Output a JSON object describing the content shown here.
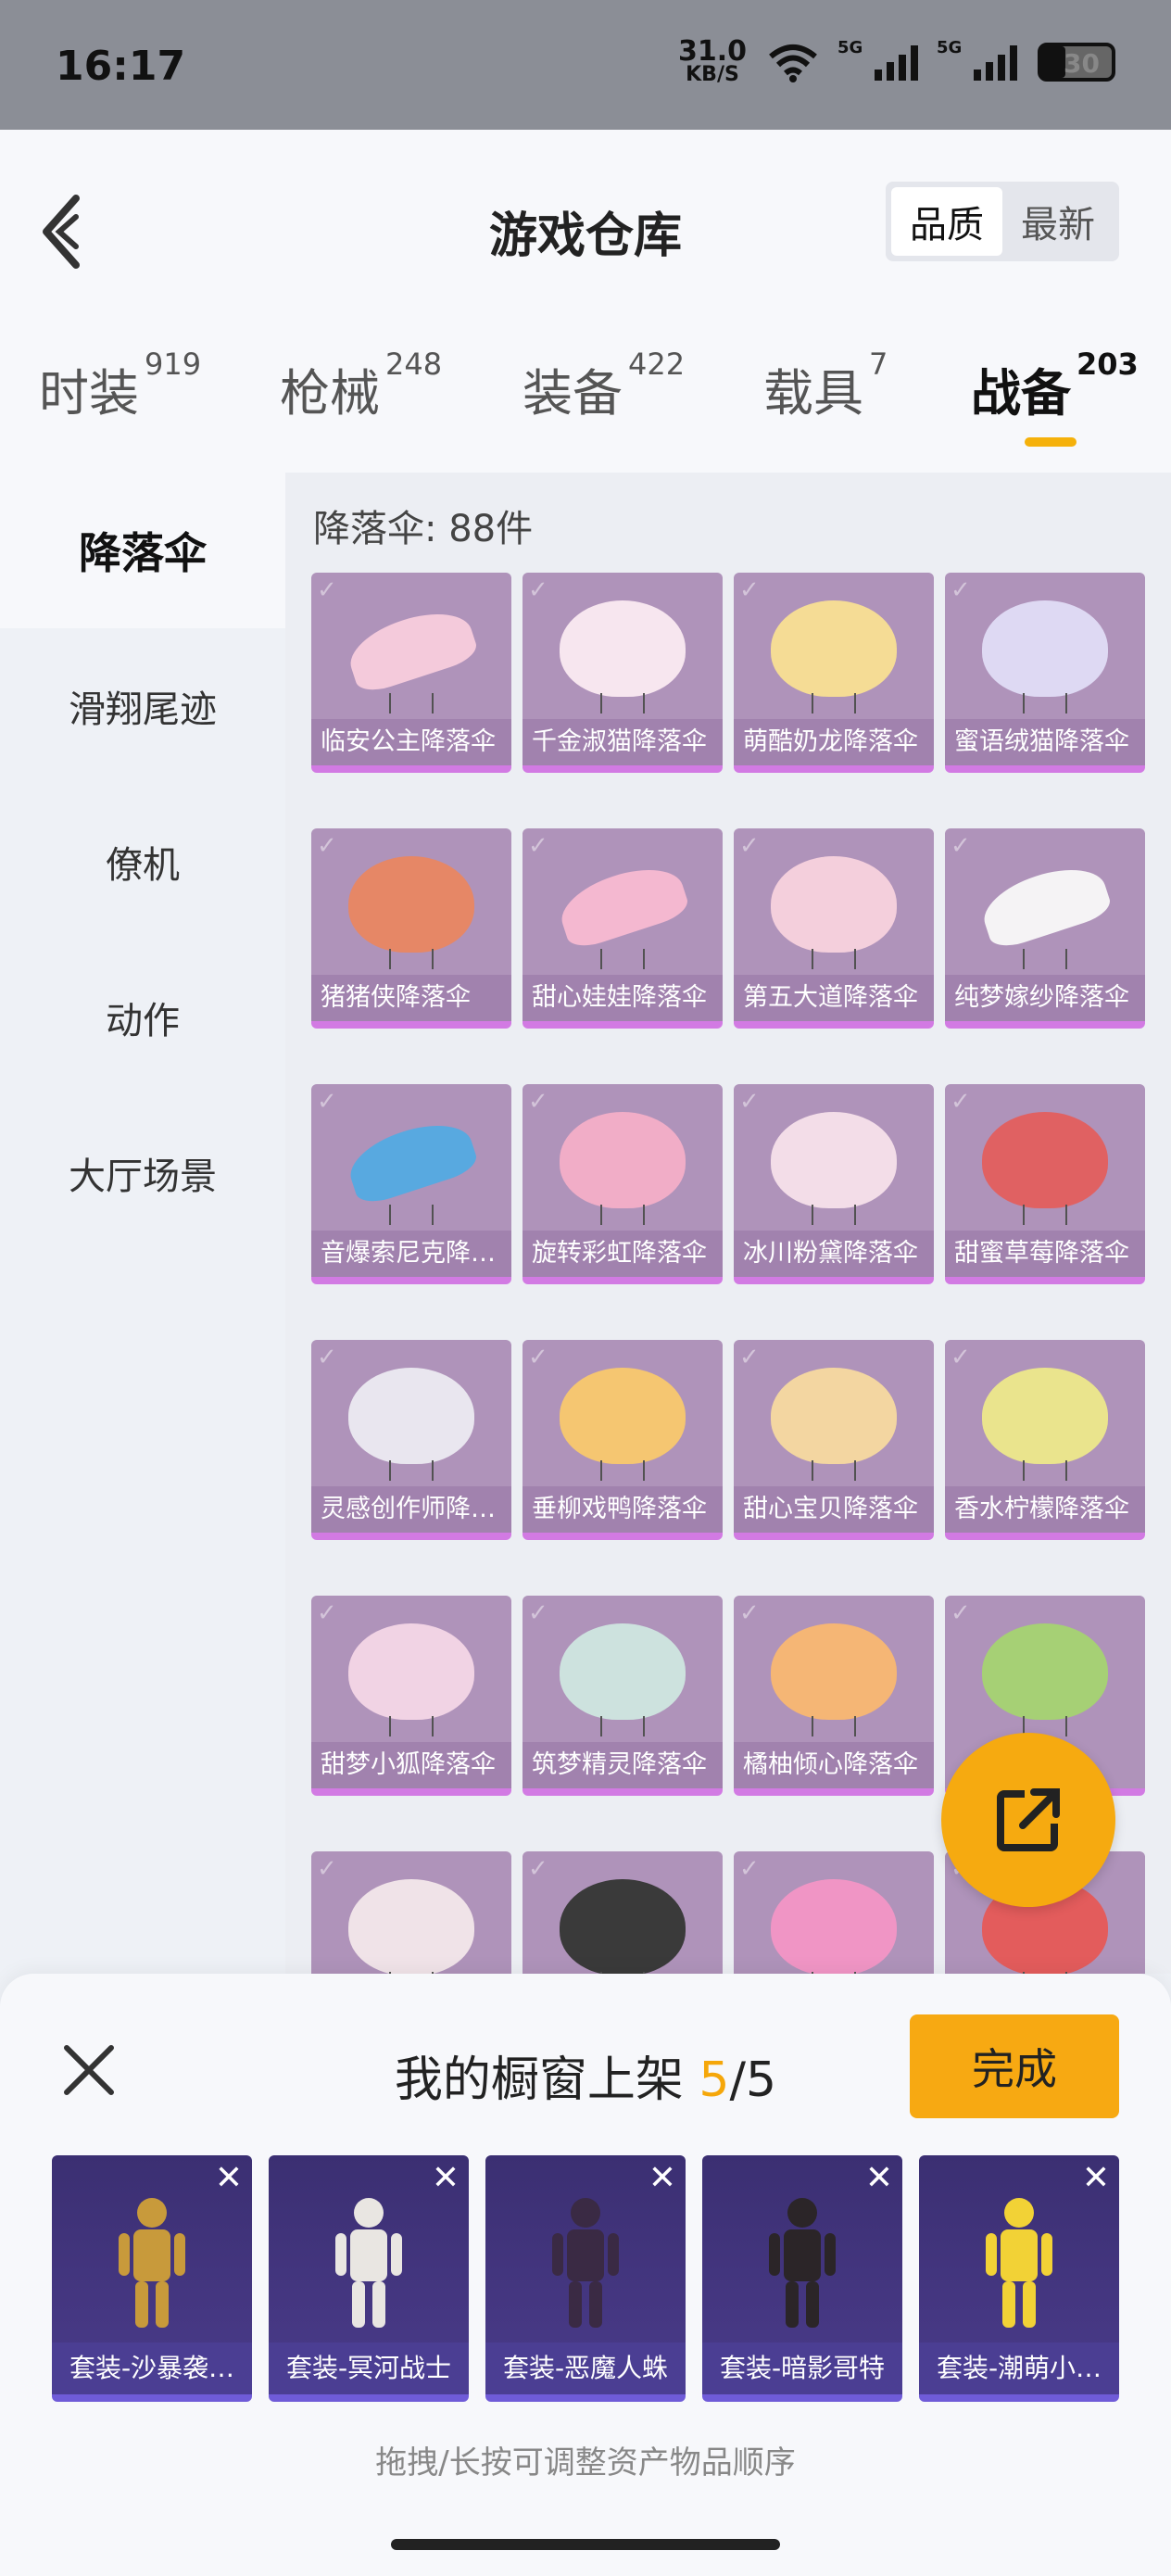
{
  "status": {
    "time": "16:17",
    "speed_value": "31.0",
    "speed_unit": "KB/S",
    "sig1": "5G",
    "sig2": "5G",
    "battery": "30"
  },
  "header": {
    "title": "游戏仓库",
    "sort": [
      "品质",
      "最新"
    ],
    "sort_active": "品质"
  },
  "tabs": [
    {
      "label": "时装",
      "count": "919"
    },
    {
      "label": "枪械",
      "count": "248"
    },
    {
      "label": "装备",
      "count": "422"
    },
    {
      "label": "载具",
      "count": "7"
    },
    {
      "label": "战备",
      "count": "203"
    }
  ],
  "active_tab": "战备",
  "sidebar": [
    "降落伞",
    "滑翔尾迹",
    "僚机",
    "动作",
    "大厅场景"
  ],
  "active_category": "降落伞",
  "content": {
    "count_label": "降落伞: 88件",
    "items": [
      {
        "name": "临安公主降落伞",
        "color": "#f4c6d8"
      },
      {
        "name": "千金淑猫降落伞",
        "color": "#f7e4ee"
      },
      {
        "name": "萌酷奶龙降落伞",
        "color": "#f5d98c"
      },
      {
        "name": "蜜语绒猫降落伞",
        "color": "#dcd6f2"
      },
      {
        "name": "猪猪侠降落伞",
        "color": "#e47d5a"
      },
      {
        "name": "甜心娃娃降落伞",
        "color": "#f3b2cc"
      },
      {
        "name": "第五大道降落伞",
        "color": "#f3cbd9"
      },
      {
        "name": "纯梦嫁纱降落伞",
        "color": "#f5f2f5"
      },
      {
        "name": "音爆索尼克降落伞",
        "color": "#4aa2de"
      },
      {
        "name": "旋转彩虹降落伞",
        "color": "#f0a7c3"
      },
      {
        "name": "冰川粉黛降落伞",
        "color": "#f2dbe6"
      },
      {
        "name": "甜蜜草莓降落伞",
        "color": "#de5455"
      },
      {
        "name": "灵感创作师降落伞",
        "color": "#e8e4ee"
      },
      {
        "name": "垂柳戏鸭降落伞",
        "color": "#f5c265"
      },
      {
        "name": "甜心宝贝降落伞",
        "color": "#f2d39a"
      },
      {
        "name": "香水柠檬降落伞",
        "color": "#e9e284"
      },
      {
        "name": "甜梦小狐降落伞",
        "color": "#f0d0e2"
      },
      {
        "name": "筑梦精灵降落伞",
        "color": "#c9e0dc"
      },
      {
        "name": "橘柚倾心降落伞",
        "color": "#f5b06a"
      },
      {
        "name": "",
        "color": "#9fcc6a"
      },
      {
        "name": "",
        "color": "#efe1e6"
      },
      {
        "name": "",
        "color": "#2a2a2a"
      },
      {
        "name": "",
        "color": "#ef8dc0"
      },
      {
        "name": "",
        "color": "#e14f4f"
      }
    ]
  },
  "panel": {
    "title_prefix": "我的橱窗上架 ",
    "current": "5",
    "total": "/5",
    "done_label": "完成",
    "outfits": [
      {
        "name": "套装-沙暴袭…",
        "color": "#c89a3b"
      },
      {
        "name": "套装-冥河战士",
        "color": "#e9e6e2"
      },
      {
        "name": "套装-恶魔人蛛",
        "color": "#3a2a44"
      },
      {
        "name": "套装-暗影哥特",
        "color": "#2b2528"
      },
      {
        "name": "套装-潮萌小…",
        "color": "#f2d236"
      }
    ],
    "hint": "拖拽/长按可调整资产物品顺序"
  }
}
